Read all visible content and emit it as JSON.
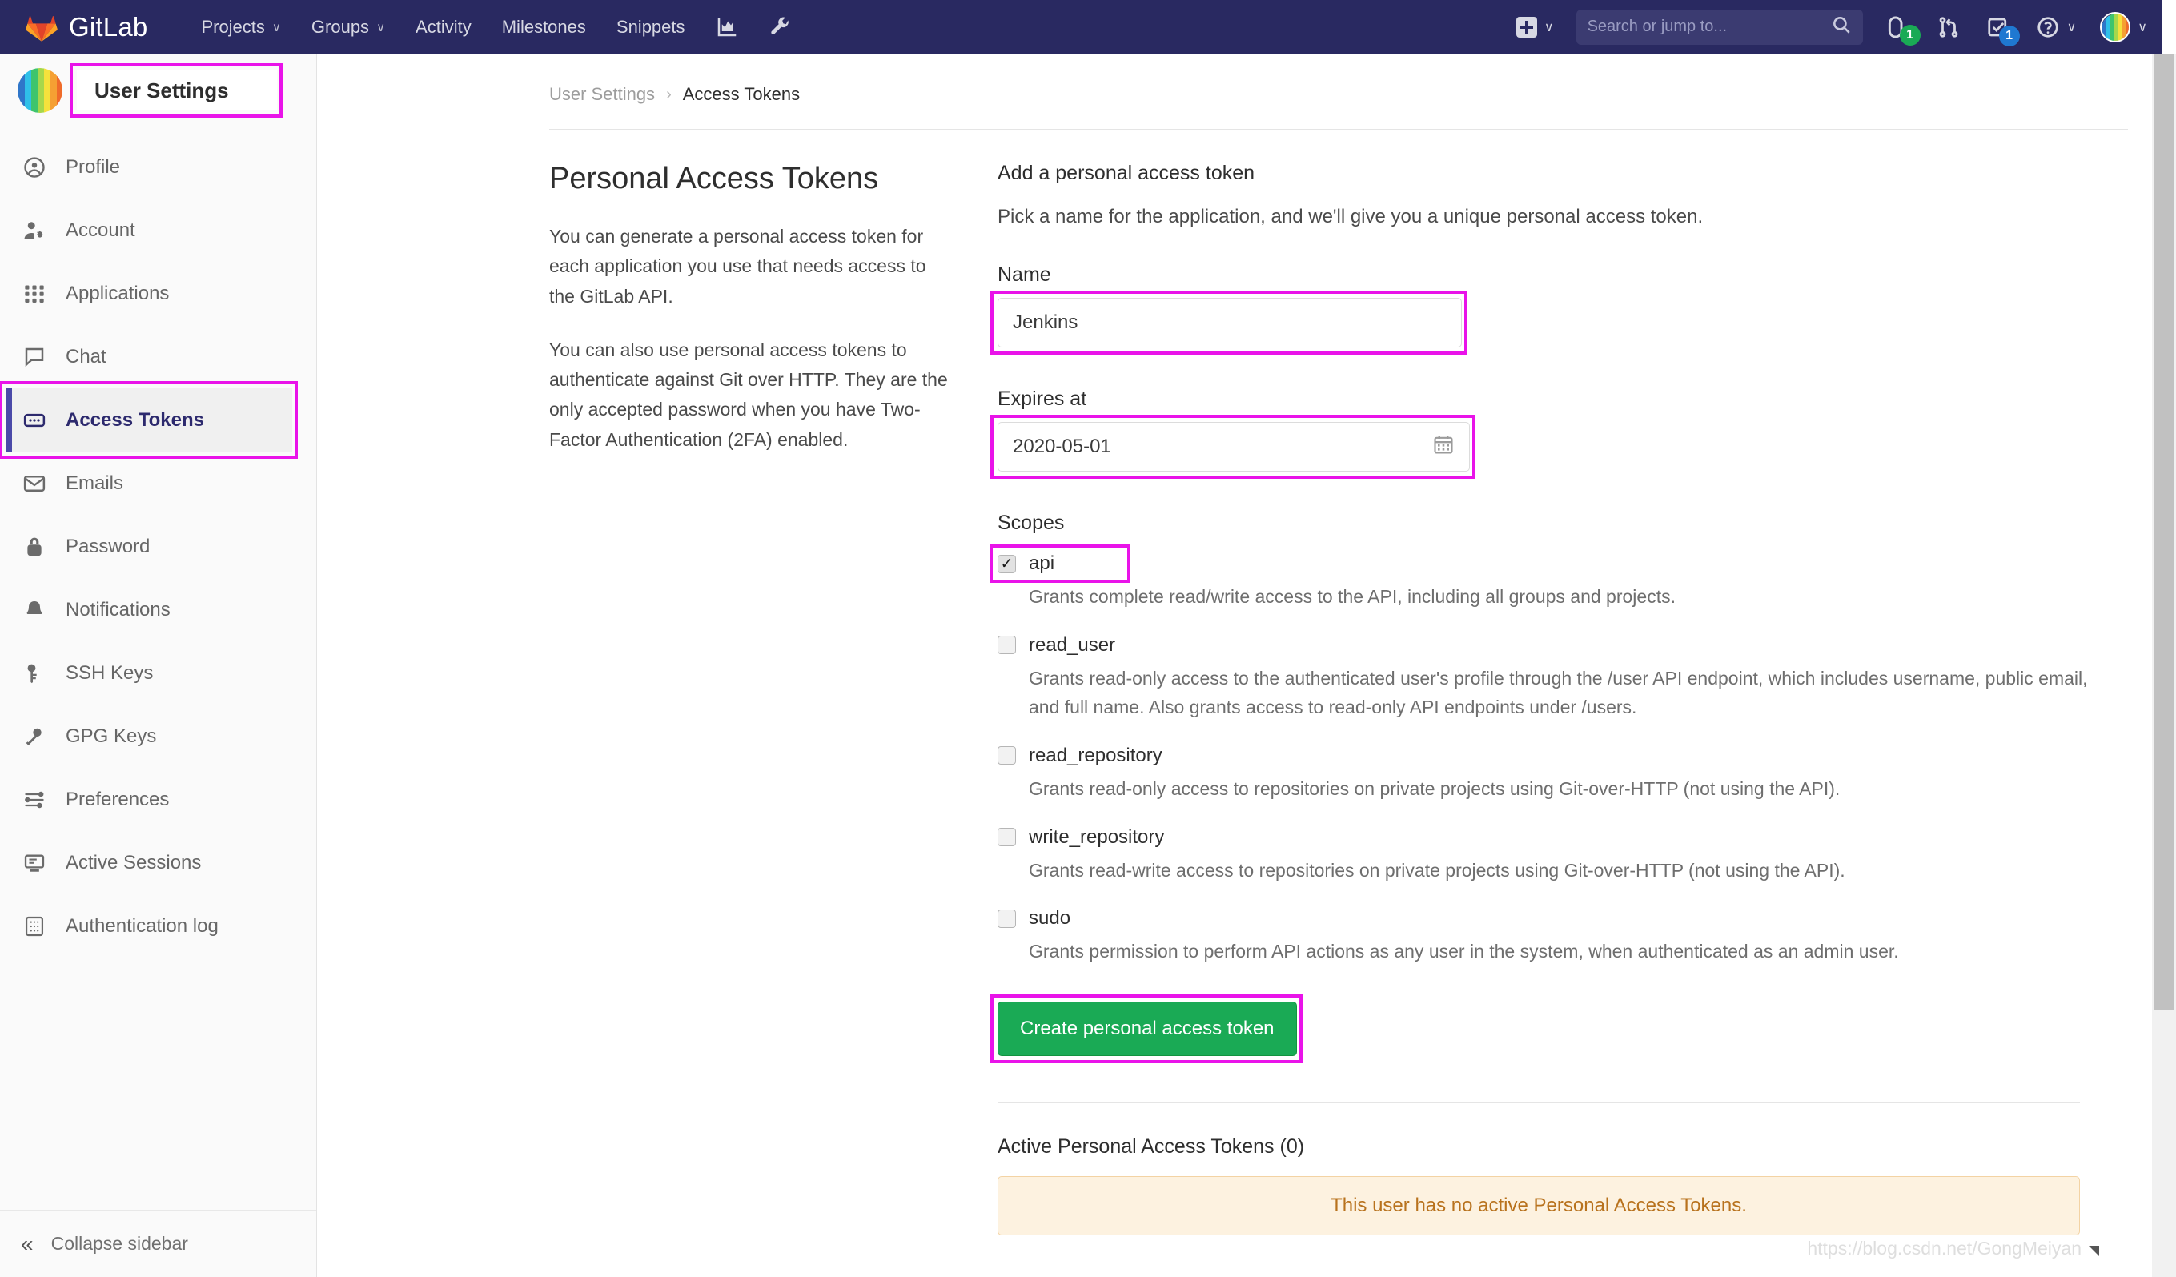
{
  "navbar": {
    "brand": "GitLab",
    "brand_icon": "gitlab-tanuki-logo",
    "links": [
      {
        "label": "Projects",
        "caret": "∨"
      },
      {
        "label": "Groups",
        "caret": "∨"
      },
      {
        "label": "Activity",
        "caret": ""
      },
      {
        "label": "Milestones",
        "caret": ""
      },
      {
        "label": "Snippets",
        "caret": ""
      }
    ],
    "analytics_icon": "analytics-chart-icon",
    "admin_icon": "wrench-icon",
    "plus_icon": "plus-square-icon",
    "plus_caret": "∨",
    "search": {
      "placeholder": "Search or jump to...",
      "value": "",
      "icon": "search-icon"
    },
    "issues": {
      "icon": "issues-icon",
      "count": "1",
      "badge_color": "#1aaa55"
    },
    "merge_requests": {
      "icon": "merge-request-icon"
    },
    "todos": {
      "icon": "todo-checkbox-icon",
      "count": "1",
      "badge_color": "#1f78d1"
    },
    "help": {
      "icon": "question-circle-icon",
      "caret": "∨"
    },
    "user": {
      "icon": "avatar",
      "caret": "∨"
    }
  },
  "sidebar": {
    "avatar_icon": "user-avatar",
    "title": "User Settings",
    "items": [
      {
        "label": "Profile",
        "icon": "user-circle-icon",
        "active": false
      },
      {
        "label": "Account",
        "icon": "user-gear-icon",
        "active": false
      },
      {
        "label": "Applications",
        "icon": "grid-apps-icon",
        "active": false
      },
      {
        "label": "Chat",
        "icon": "chat-bubble-icon",
        "active": false
      },
      {
        "label": "Access Tokens",
        "icon": "token-card-icon",
        "active": true
      },
      {
        "label": "Emails",
        "icon": "envelope-icon",
        "active": false
      },
      {
        "label": "Password",
        "icon": "lock-icon",
        "active": false
      },
      {
        "label": "Notifications",
        "icon": "bell-icon",
        "active": false
      },
      {
        "label": "SSH Keys",
        "icon": "key-icon",
        "active": false
      },
      {
        "label": "GPG Keys",
        "icon": "key-icon",
        "active": false
      },
      {
        "label": "Preferences",
        "icon": "sliders-icon",
        "active": false
      },
      {
        "label": "Active Sessions",
        "icon": "monitor-icon",
        "active": false
      },
      {
        "label": "Authentication log",
        "icon": "log-list-icon",
        "active": false
      }
    ],
    "collapse": {
      "label": "Collapse sidebar",
      "icon": "double-chevron-left-icon"
    }
  },
  "breadcrumb": {
    "parent": "User Settings",
    "separator": "›",
    "current": "Access Tokens"
  },
  "left_column": {
    "heading": "Personal Access Tokens",
    "paragraph1": "You can generate a personal access token for each application you use that needs access to the GitLab API.",
    "paragraph2": "You can also use personal access tokens to authenticate against Git over HTTP. They are the only accepted password when you have Two-Factor Authentication (2FA) enabled."
  },
  "form": {
    "heading": "Add a personal access token",
    "lead": "Pick a name for the application, and we'll give you a unique personal access token.",
    "name_label": "Name",
    "name_value": "Jenkins",
    "name_placeholder": "",
    "expires_label": "Expires at",
    "expires_value": "2020-05-01",
    "calendar_icon": "calendar-icon",
    "scopes_label": "Scopes",
    "scopes": [
      {
        "name": "api",
        "checked": true,
        "description": "Grants complete read/write access to the API, including all groups and projects."
      },
      {
        "name": "read_user",
        "checked": false,
        "description": "Grants read-only access to the authenticated user's profile through the /user API endpoint, which includes username, public email, and full name. Also grants access to read-only API endpoints under /users."
      },
      {
        "name": "read_repository",
        "checked": false,
        "description": "Grants read-only access to repositories on private projects using Git-over-HTTP (not using the API)."
      },
      {
        "name": "write_repository",
        "checked": false,
        "description": "Grants read-write access to repositories on private projects using Git-over-HTTP (not using the API)."
      },
      {
        "name": "sudo",
        "checked": false,
        "description": "Grants permission to perform API actions as any user in the system, when authenticated as an admin user."
      }
    ],
    "submit_label": "Create personal access token"
  },
  "active_tokens": {
    "heading": "Active Personal Access Tokens (0)",
    "empty_message": "This user has no active Personal Access Tokens."
  },
  "watermark": "https://blog.csdn.net/GongMeiyan",
  "colors": {
    "navbar_bg": "#292961",
    "accent_green": "#1aaa55",
    "annotation": "#e913e9",
    "active_sidebar_text": "#2d2a6e",
    "warning_text": "#b8721d",
    "warning_bg": "#fdf2e0"
  }
}
